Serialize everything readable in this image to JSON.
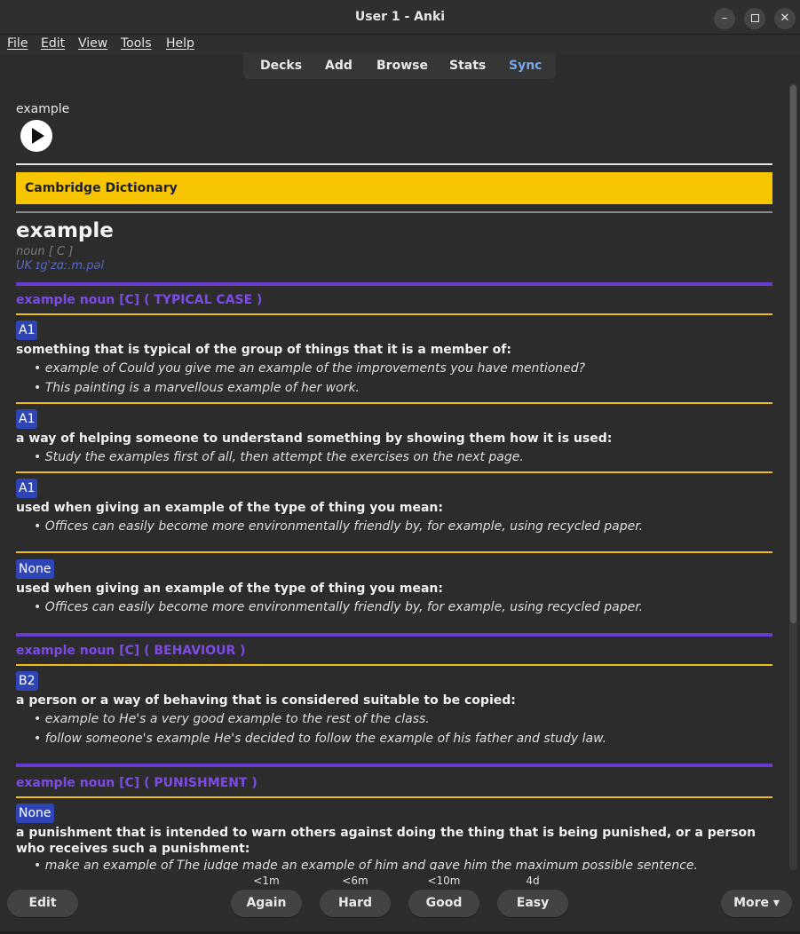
{
  "window": {
    "title": "User 1 - Anki",
    "controls": [
      "minimize-icon",
      "maximize-icon",
      "close-icon"
    ]
  },
  "menu": [
    "File",
    "Edit",
    "View",
    "Tools",
    "Help"
  ],
  "toolbar": {
    "decks": "Decks",
    "add": "Add",
    "browse": "Browse",
    "stats": "Stats",
    "sync": "Sync",
    "sync_color": "#78a6e6"
  },
  "card": {
    "front_word": "example",
    "dictionary": "Cambridge Dictionary",
    "headword": "example",
    "pos": "noun [ C ]",
    "pron": "UK ɪɡˈzɑː.m.pəl",
    "senses": [
      {
        "header": "example noun [C] ( TYPICAL CASE )",
        "entries": [
          {
            "level": "A1",
            "definition": "something that is typical of the group of things that it is a member of:",
            "examples": [
              "• example of Could you give me an example of the improvements you have mentioned?",
              "• This painting is a marvellous example of her work."
            ]
          },
          {
            "level": "A1",
            "definition": "a way of helping someone to understand something by showing them how it is used:",
            "examples": [
              "• Study the examples first of all, then attempt the exercises on the next page."
            ]
          },
          {
            "level": "A1",
            "definition": "used when giving an example of the type of thing you mean:",
            "examples": [
              "• Offices can easily become more environmentally friendly by, for example, using recycled paper."
            ]
          },
          {
            "level": "None",
            "definition": "used when giving an example of the type of thing you mean:",
            "examples": [
              "• Offices can easily become more environmentally friendly by, for example, using recycled paper."
            ]
          }
        ]
      },
      {
        "header": "example noun [C] ( BEHAVIOUR )",
        "entries": [
          {
            "level": "B2",
            "definition": "a person or a way of behaving that is considered suitable to be copied:",
            "examples": [
              "• example to He's a very good example to the rest of the class.",
              "• follow someone's example He's decided to follow the example of his father and study law."
            ]
          }
        ]
      },
      {
        "header": "example noun [C] ( PUNISHMENT )",
        "entries": [
          {
            "level": "None",
            "definition": "a punishment that is intended to warn others against doing the thing that is being punished, or a person who receives such a punishment:",
            "examples": [
              "• make an example of The judge made an example of him and gave him the maximum possible sentence."
            ]
          }
        ]
      }
    ]
  },
  "review": {
    "edit": "Edit",
    "more": "More ▾",
    "answers": [
      {
        "label": "Again",
        "interval": "<1m"
      },
      {
        "label": "Hard",
        "interval": "<6m"
      },
      {
        "label": "Good",
        "interval": "<10m"
      },
      {
        "label": "Easy",
        "interval": "4d"
      }
    ]
  },
  "colors": {
    "banner": "#f7c600",
    "sense_header": "#7d4ae8",
    "purple_rule": "#6a3bd1",
    "gold_rule": "#f0be12",
    "badge": "#2f44b5"
  }
}
